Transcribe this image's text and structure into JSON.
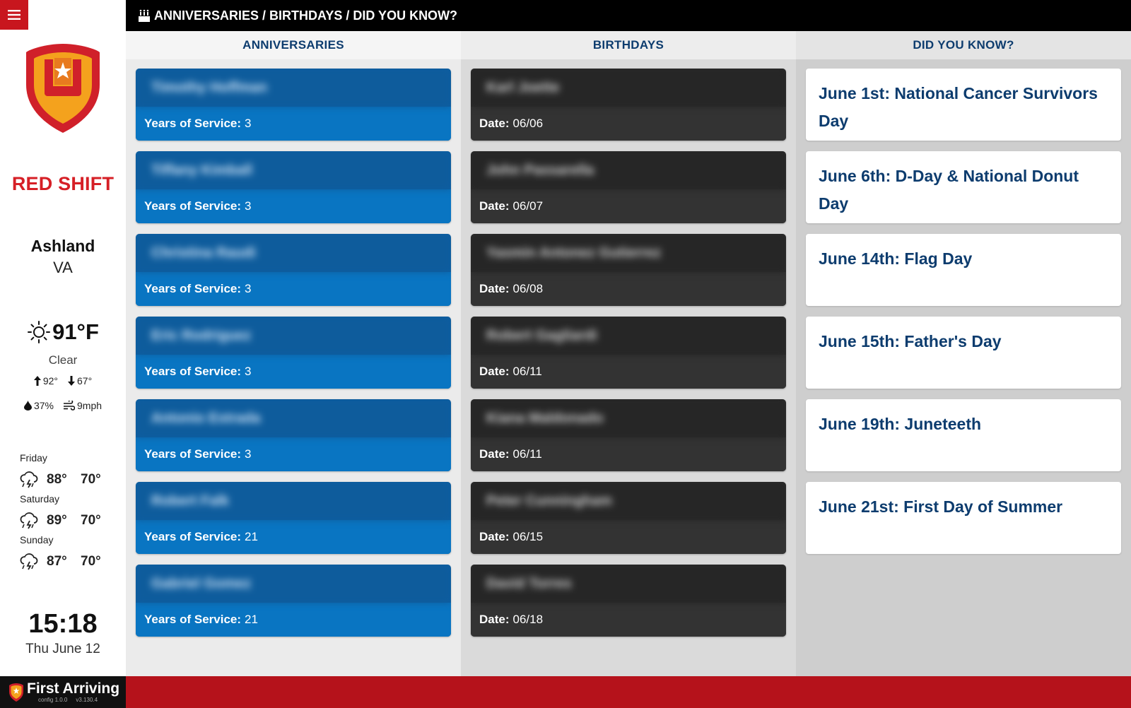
{
  "app": {
    "brand_name": "RED SHIFT",
    "location": {
      "city": "Ashland",
      "state": "VA"
    },
    "colors": {
      "brand_red": "#d61f26",
      "navy": "#0d3c6e",
      "blue": "#0975c2",
      "dark": "#333333"
    }
  },
  "weather": {
    "current_temp": "91°F",
    "condition": "Clear",
    "high": "92°",
    "low": "67°",
    "humidity": "37%",
    "wind": "9mph",
    "forecast": [
      {
        "day": "Friday",
        "high": "88°",
        "low": "70°",
        "icon": "thunderstorm-icon"
      },
      {
        "day": "Saturday",
        "high": "89°",
        "low": "70°",
        "icon": "thunderstorm-icon"
      },
      {
        "day": "Sunday",
        "high": "87°",
        "low": "70°",
        "icon": "thunderstorm-icon"
      }
    ]
  },
  "clock": {
    "time": "15:18",
    "date": "Thu June 12"
  },
  "topbar": {
    "title": "ANNIVERSARIES / BIRTHDAYS / DID YOU KNOW?",
    "icon": "birthday-cake-icon"
  },
  "footer": {
    "brand": "First Arriving",
    "config": "config 1.0.0",
    "version": "v3.130.4"
  },
  "columns": {
    "anniversaries": {
      "header": "ANNIVERSARIES",
      "label": "Years of Service:",
      "items": [
        {
          "name": "Timothy Hoffman",
          "value": "3"
        },
        {
          "name": "Tiffany Kimball",
          "value": "3"
        },
        {
          "name": "Christina Raudi",
          "value": "3"
        },
        {
          "name": "Eric Rodriguez",
          "value": "3"
        },
        {
          "name": "Antonio Estrada",
          "value": "3"
        },
        {
          "name": "Robert Falk",
          "value": "21"
        },
        {
          "name": "Gabriel Gomez",
          "value": "21"
        }
      ]
    },
    "birthdays": {
      "header": "BIRTHDAYS",
      "label": "Date:",
      "items": [
        {
          "name": "Karl Joette",
          "value": "06/06"
        },
        {
          "name": "John Passarella",
          "value": "06/07"
        },
        {
          "name": "Yasmin Antonez Gutierrez",
          "value": "06/08"
        },
        {
          "name": "Robert Gagliardi",
          "value": "06/11"
        },
        {
          "name": "Kiana Maldonado",
          "value": "06/11"
        },
        {
          "name": "Peter Cunningham",
          "value": "06/15"
        },
        {
          "name": "David Torres",
          "value": "06/18"
        }
      ]
    },
    "did_you_know": {
      "header": "DID YOU KNOW?",
      "items": [
        "June 1st: National Cancer Survivors Day",
        "June 6th: D-Day & National Donut Day",
        "June 14th: Flag Day",
        "June 15th: Father's Day",
        "June 19th: Juneteeth",
        "June 21st: First Day of Summer"
      ]
    }
  }
}
